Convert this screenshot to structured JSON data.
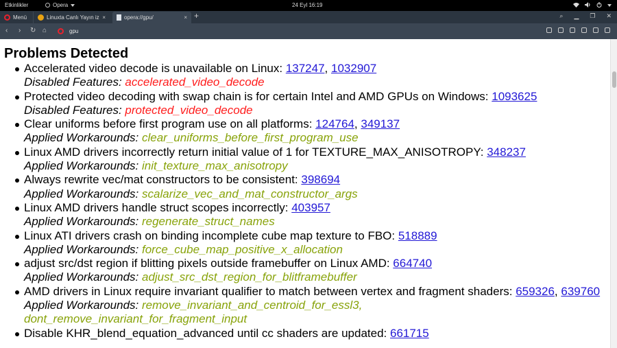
{
  "topbar": {
    "activities": "Etkinlikler",
    "app": "Opera",
    "clock": "24 Eyl  16:19",
    "tray_icons": [
      "wifi-icon",
      "volume-icon",
      "power-icon"
    ]
  },
  "tabs": {
    "menu_label": "Menü",
    "items": [
      {
        "title": "Linuxta Canlı Yayın iz",
        "icon": "twitch-icon"
      },
      {
        "title": "opera://gpu/",
        "icon": "document-icon"
      }
    ],
    "new_tab": "+"
  },
  "addressbar": {
    "url": "gpu",
    "nav_icons": [
      "back-icon",
      "forward-icon",
      "reload-icon",
      "home-icon"
    ],
    "right_icons": [
      "camera-icon",
      "heart-icon",
      "cube-icon",
      "download-icon",
      "battery-icon",
      "menu-icon"
    ]
  },
  "page": {
    "heading": "Problems Detected",
    "problems": [
      {
        "text": "Accelerated video decode is unavailable on Linux: ",
        "links": [
          "137247",
          "1032907"
        ],
        "kind": "Disabled Features: ",
        "detail": "accelerated_video_decode",
        "detail_color": "red"
      },
      {
        "text": "Protected video decoding with swap chain is for certain Intel and AMD GPUs on Windows: ",
        "links": [
          "1093625"
        ],
        "kind": "Disabled Features: ",
        "detail": "protected_video_decode",
        "detail_color": "red"
      },
      {
        "text": "Clear uniforms before first program use on all platforms: ",
        "links": [
          "124764",
          "349137"
        ],
        "kind": "Applied Workarounds: ",
        "detail": "clear_uniforms_before_first_program_use",
        "detail_color": "olive"
      },
      {
        "text": "Linux AMD drivers incorrectly return initial value of 1 for TEXTURE_MAX_ANISOTROPY: ",
        "links": [
          "348237"
        ],
        "kind": "Applied Workarounds: ",
        "detail": "init_texture_max_anisotropy",
        "detail_color": "olive"
      },
      {
        "text": "Always rewrite vec/mat constructors to be consistent: ",
        "links": [
          "398694"
        ],
        "kind": "Applied Workarounds: ",
        "detail": "scalarize_vec_and_mat_constructor_args",
        "detail_color": "olive"
      },
      {
        "text": "Linux AMD drivers handle struct scopes incorrectly: ",
        "links": [
          "403957"
        ],
        "kind": "Applied Workarounds: ",
        "detail": "regenerate_struct_names",
        "detail_color": "olive"
      },
      {
        "text": "Linux ATI drivers crash on binding incomplete cube map texture to FBO: ",
        "links": [
          "518889"
        ],
        "kind": "Applied Workarounds: ",
        "detail": "force_cube_map_positive_x_allocation",
        "detail_color": "olive"
      },
      {
        "text": "adjust src/dst region if blitting pixels outside framebuffer on Linux AMD: ",
        "links": [
          "664740"
        ],
        "kind": "Applied Workarounds: ",
        "detail": "adjust_src_dst_region_for_blitframebuffer",
        "detail_color": "olive"
      },
      {
        "text": "AMD drivers in Linux require invariant qualifier to match between vertex and fragment shaders: ",
        "links": [
          "659326",
          "639760"
        ],
        "kind": "Applied Workarounds: ",
        "detail": "remove_invariant_and_centroid_for_essl3,\ndont_remove_invariant_for_fragment_input",
        "detail_color": "olive"
      },
      {
        "text": "Disable KHR_blend_equation_advanced until cc shaders are updated: ",
        "links": [
          "661715"
        ],
        "kind": "",
        "detail": "",
        "detail_color": "olive"
      }
    ]
  }
}
